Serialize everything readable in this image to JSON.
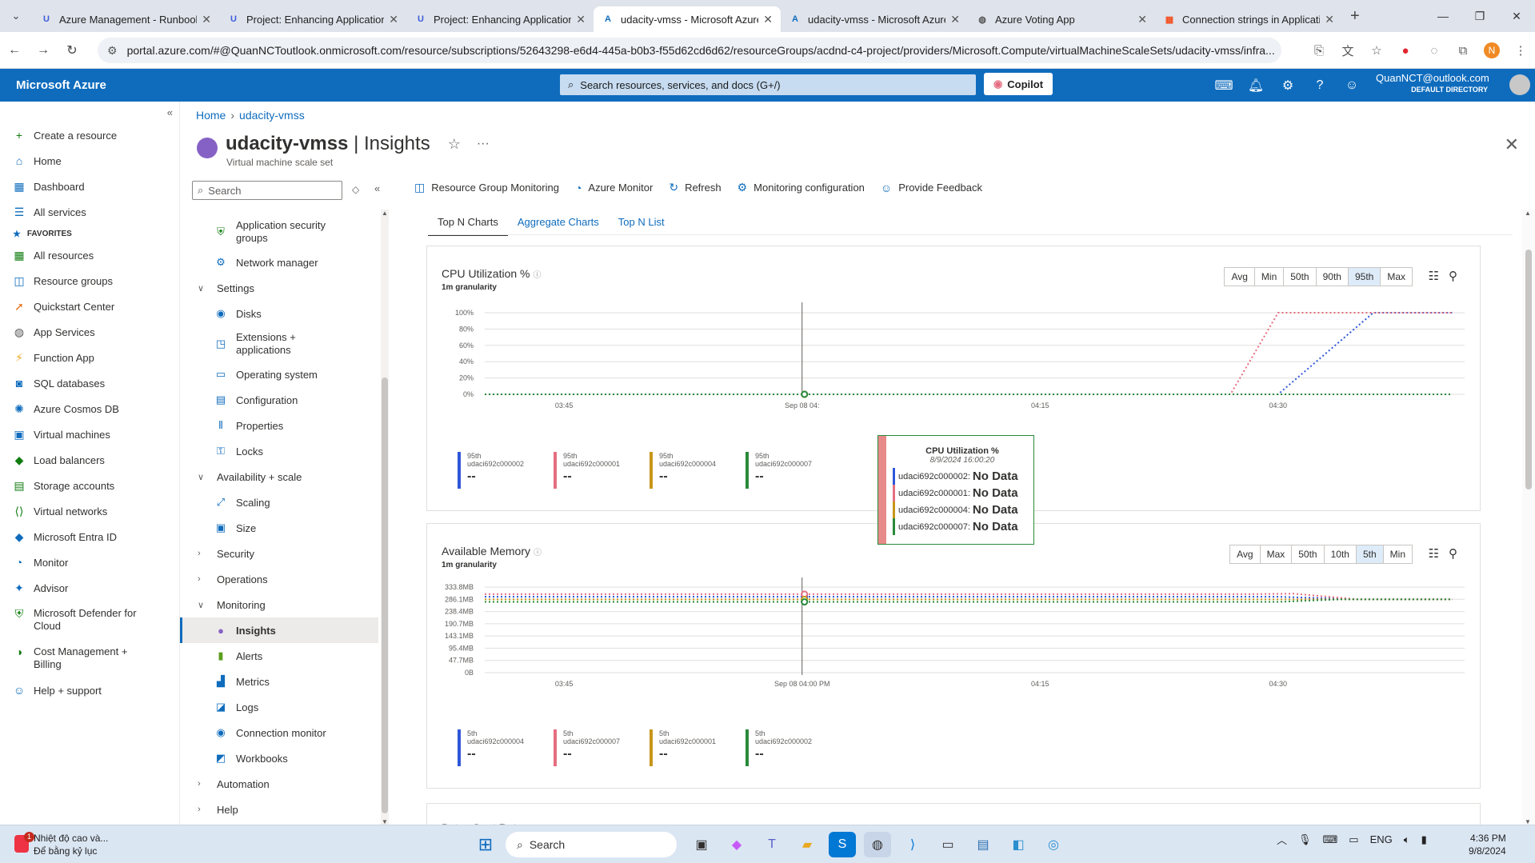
{
  "browser": {
    "tabs": [
      {
        "title": "Azure Management - Runbook",
        "icon": "udacity-icon"
      },
      {
        "title": "Project: Enhancing Applications",
        "icon": "udacity-icon"
      },
      {
        "title": "Project: Enhancing Applications",
        "icon": "udacity-icon"
      },
      {
        "title": "udacity-vmss - Microsoft Azure",
        "icon": "azure-icon"
      },
      {
        "title": "udacity-vmss - Microsoft Azure",
        "icon": "azure-icon"
      },
      {
        "title": "Azure Voting App",
        "icon": "globe-icon"
      },
      {
        "title": "Connection strings in Applicatio",
        "icon": "microsoft-icon"
      }
    ],
    "active_tab_index": 3,
    "url": "portal.azure.com/#@QuanNCToutlook.onmicrosoft.com/resource/subscriptions/52643298-e6d4-445a-b0b3-f55d62cd6d62/resourceGroups/acdnd-c4-project/providers/Microsoft.Compute/virtualMachineScaleSets/udacity-vmss/infra..."
  },
  "portal": {
    "brand": "Microsoft Azure",
    "search_placeholder": "Search resources, services, and docs (G+/)",
    "copilot_label": "Copilot",
    "user_email": "QuanNCT@outlook.com",
    "user_directory": "DEFAULT DIRECTORY"
  },
  "left_nav": {
    "items_top": [
      {
        "label": "Create a resource",
        "icon": "plus-icon"
      },
      {
        "label": "Home",
        "icon": "home-icon"
      },
      {
        "label": "Dashboard",
        "icon": "dashboard-icon"
      },
      {
        "label": "All services",
        "icon": "list-icon"
      }
    ],
    "favorites_label": "FAVORITES",
    "favorites": [
      {
        "label": "All resources",
        "icon": "grid-icon"
      },
      {
        "label": "Resource groups",
        "icon": "resource-group-icon"
      },
      {
        "label": "Quickstart Center",
        "icon": "rocket-icon"
      },
      {
        "label": "App Services",
        "icon": "globe-icon"
      },
      {
        "label": "Function App",
        "icon": "lightning-icon"
      },
      {
        "label": "SQL databases",
        "icon": "sql-icon"
      },
      {
        "label": "Azure Cosmos DB",
        "icon": "cosmos-icon"
      },
      {
        "label": "Virtual machines",
        "icon": "vm-icon"
      },
      {
        "label": "Load balancers",
        "icon": "load-balancer-icon"
      },
      {
        "label": "Storage accounts",
        "icon": "storage-icon"
      },
      {
        "label": "Virtual networks",
        "icon": "vnet-icon"
      },
      {
        "label": "Microsoft Entra ID",
        "icon": "entra-icon"
      },
      {
        "label": "Monitor",
        "icon": "monitor-icon"
      },
      {
        "label": "Advisor",
        "icon": "advisor-icon"
      },
      {
        "label": "Microsoft Defender for Cloud",
        "icon": "shield-icon"
      },
      {
        "label": "Cost Management + Billing",
        "icon": "cost-icon"
      },
      {
        "label": "Help + support",
        "icon": "help-icon"
      }
    ]
  },
  "breadcrumb": [
    "Home",
    "udacity-vmss"
  ],
  "resource": {
    "name": "udacity-vmss",
    "page": "Insights",
    "separator": " | ",
    "type": "Virtual machine scale set"
  },
  "blade": {
    "search_placeholder": "Search",
    "menu": [
      {
        "kind": "item",
        "label": "Application security groups",
        "icon": "shield-icon",
        "two": true
      },
      {
        "kind": "item",
        "label": "Network manager",
        "icon": "network-icon"
      },
      {
        "kind": "group",
        "label": "Settings",
        "expanded": true
      },
      {
        "kind": "item",
        "label": "Disks",
        "icon": "disk-icon"
      },
      {
        "kind": "item",
        "label": "Extensions + applications",
        "icon": "extension-icon",
        "two": true
      },
      {
        "kind": "item",
        "label": "Operating system",
        "icon": "os-icon"
      },
      {
        "kind": "item",
        "label": "Configuration",
        "icon": "config-icon"
      },
      {
        "kind": "item",
        "label": "Properties",
        "icon": "properties-icon"
      },
      {
        "kind": "item",
        "label": "Locks",
        "icon": "lock-icon"
      },
      {
        "kind": "group",
        "label": "Availability + scale",
        "expanded": true
      },
      {
        "kind": "item",
        "label": "Scaling",
        "icon": "scaling-icon"
      },
      {
        "kind": "item",
        "label": "Size",
        "icon": "size-icon"
      },
      {
        "kind": "group",
        "label": "Security",
        "expanded": false
      },
      {
        "kind": "group",
        "label": "Operations",
        "expanded": false
      },
      {
        "kind": "group",
        "label": "Monitoring",
        "expanded": true
      },
      {
        "kind": "item",
        "label": "Insights",
        "icon": "insights-icon",
        "active": true
      },
      {
        "kind": "item",
        "label": "Alerts",
        "icon": "alerts-icon"
      },
      {
        "kind": "item",
        "label": "Metrics",
        "icon": "metrics-icon"
      },
      {
        "kind": "item",
        "label": "Logs",
        "icon": "logs-icon"
      },
      {
        "kind": "item",
        "label": "Connection monitor",
        "icon": "connection-icon"
      },
      {
        "kind": "item",
        "label": "Workbooks",
        "icon": "workbooks-icon"
      },
      {
        "kind": "group",
        "label": "Automation",
        "expanded": false
      },
      {
        "kind": "group",
        "label": "Help",
        "expanded": false
      }
    ]
  },
  "commands": [
    {
      "label": "Resource Group Monitoring",
      "icon": "resource-group-icon"
    },
    {
      "label": "Azure Monitor",
      "icon": "monitor-icon"
    },
    {
      "label": "Refresh",
      "icon": "refresh-icon"
    },
    {
      "label": "Monitoring configuration",
      "icon": "gear-icon"
    },
    {
      "label": "Provide Feedback",
      "icon": "smiley-icon"
    }
  ],
  "insight_tabs": [
    "Top N Charts",
    "Aggregate Charts",
    "Top N List"
  ],
  "insight_tab_selected": 0,
  "colors": {
    "blue": "#2f57d8",
    "pink": "#e56e80",
    "gold": "#c8961a",
    "green": "#2a8a3a",
    "accent": "#0f6cbd"
  },
  "chart_data": [
    {
      "type": "line",
      "title": "CPU Utilization %",
      "granularity": "1m granularity",
      "aggregations": [
        "Avg",
        "Min",
        "50th",
        "90th",
        "95th",
        "Max"
      ],
      "selected_aggregation": "95th",
      "y_ticks": [
        "100%",
        "80%",
        "60%",
        "40%",
        "20%",
        "0%"
      ],
      "ylim": [
        0,
        100
      ],
      "x_ticks": [
        "03:45",
        "Sep 08 04:",
        "04:15",
        "04:30"
      ],
      "x_tick_minutes": [
        -15,
        0,
        15,
        30
      ],
      "xlim": [
        -20,
        41
      ],
      "series": [
        {
          "name": "udaci692c000002",
          "stat": "95th",
          "legend_value": "--",
          "color": "blue",
          "x": [
            -20,
            30,
            36,
            41
          ],
          "y": [
            0,
            0,
            100,
            100
          ]
        },
        {
          "name": "udaci692c000001",
          "stat": "95th",
          "legend_value": "--",
          "color": "pink",
          "x": [
            -20,
            27,
            30,
            41
          ],
          "y": [
            0,
            0,
            100,
            100
          ]
        },
        {
          "name": "udaci692c000004",
          "stat": "95th",
          "legend_value": "--",
          "color": "gold",
          "x": [
            -20,
            41
          ],
          "y": [
            0,
            0
          ]
        },
        {
          "name": "udaci692c000007",
          "stat": "95th",
          "legend_value": "--",
          "color": "green",
          "x": [
            -20,
            41
          ],
          "y": [
            0,
            0
          ]
        }
      ],
      "tooltip": {
        "title": "CPU Utilization %",
        "date": "8/9/2024 16:00:20",
        "rows": [
          {
            "name": "udaci692c000002:",
            "value": "No Data",
            "color": "blue"
          },
          {
            "name": "udaci692c000001:",
            "value": "No Data",
            "color": "pink"
          },
          {
            "name": "udaci692c000004:",
            "value": "No Data",
            "color": "gold"
          },
          {
            "name": "udaci692c000007:",
            "value": "No Data",
            "color": "green"
          }
        ]
      }
    },
    {
      "type": "line",
      "title": "Available Memory",
      "granularity": "1m granularity",
      "aggregations": [
        "Avg",
        "Max",
        "50th",
        "10th",
        "5th",
        "Min"
      ],
      "selected_aggregation": "5th",
      "y_ticks": [
        "333.8MB",
        "286.1MB",
        "238.4MB",
        "190.7MB",
        "143.1MB",
        "95.4MB",
        "47.7MB",
        "0B"
      ],
      "ylim": [
        0,
        333.8
      ],
      "x_ticks": [
        "03:45",
        "Sep 08 04:00 PM",
        "04:15",
        "04:30"
      ],
      "x_tick_minutes": [
        -15,
        0,
        15,
        30
      ],
      "xlim": [
        -20,
        41
      ],
      "series": [
        {
          "name": "udaci692c000004",
          "stat": "5th",
          "legend_value": "--",
          "color": "blue",
          "x": [
            -20,
            30,
            35,
            41
          ],
          "y": [
            296,
            296,
            286,
            286
          ]
        },
        {
          "name": "udaci692c000007",
          "stat": "5th",
          "legend_value": "--",
          "color": "pink",
          "x": [
            -20,
            28,
            31,
            35,
            41
          ],
          "y": [
            306,
            306,
            308,
            286,
            286
          ]
        },
        {
          "name": "udaci692c000001",
          "stat": "5th",
          "legend_value": "--",
          "color": "gold",
          "x": [
            -20,
            41
          ],
          "y": [
            286,
            286
          ]
        },
        {
          "name": "udaci692c000002",
          "stat": "5th",
          "legend_value": "--",
          "color": "green",
          "x": [
            -20,
            30,
            34,
            41
          ],
          "y": [
            276,
            276,
            286,
            286
          ]
        }
      ]
    }
  ],
  "next_chart_title": "Bytes Sent Rate",
  "taskbar": {
    "weather_line1": "Nhiệt độ cao và...",
    "weather_line2": "Để bằng kỷ lục",
    "weather_badge": "1",
    "search_label": "Search",
    "language": "ENG",
    "time": "4:36 PM",
    "date": "9/8/2024"
  }
}
